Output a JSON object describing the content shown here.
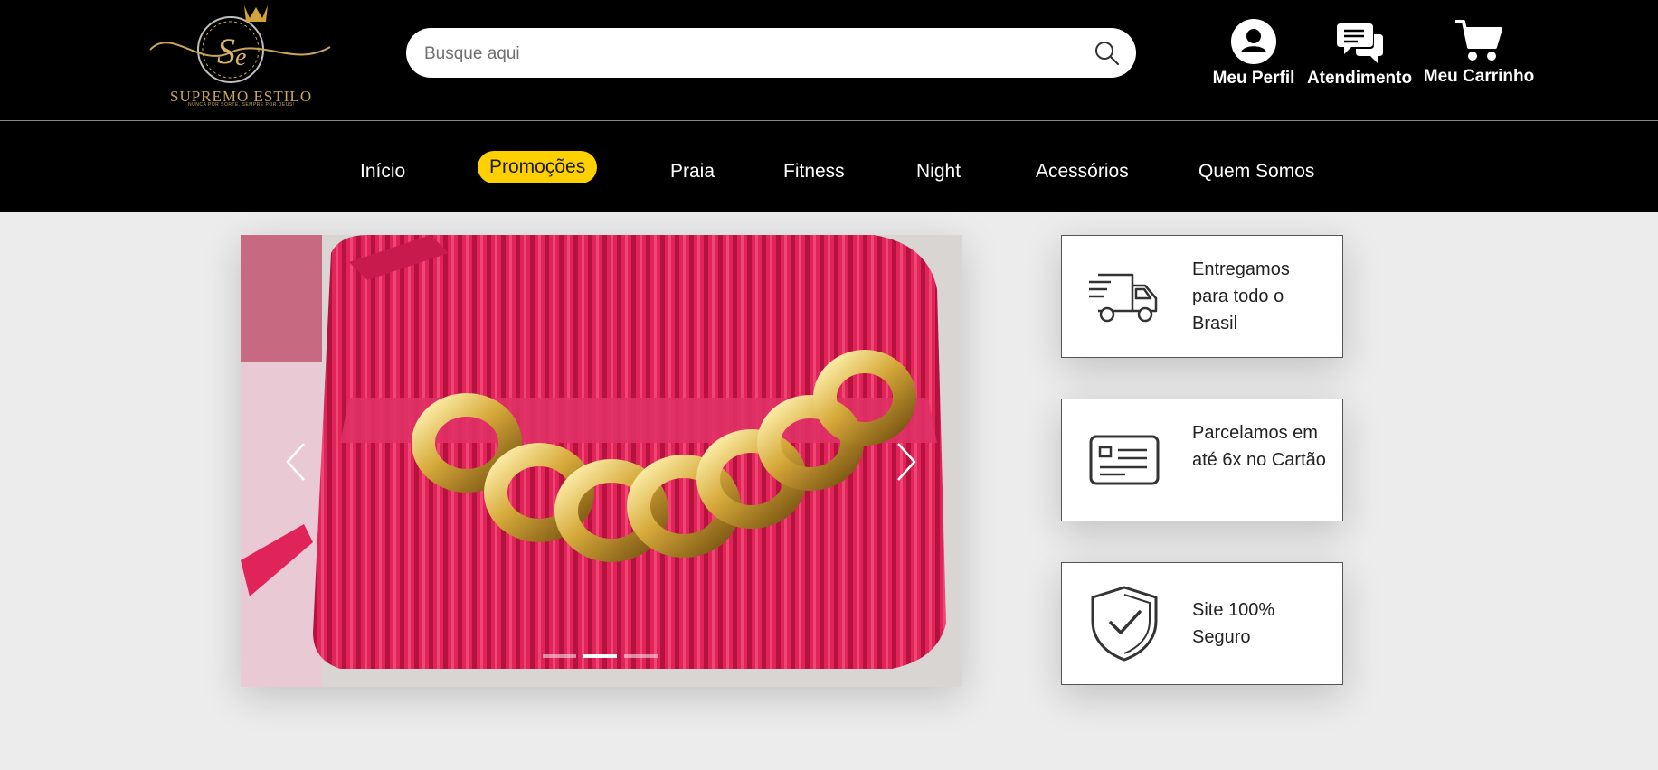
{
  "header": {
    "logo": {
      "brand": "SUPREMO ESTILO",
      "tagline": "NUNCA POR SORTE, SEMPRE POR DEUS!",
      "monogram": "Se"
    },
    "search": {
      "placeholder": "Busque aqui",
      "value": ""
    },
    "actions": [
      {
        "label": "Meu Perfil",
        "icon": "user-icon"
      },
      {
        "label": "Atendimento",
        "icon": "chat-icon"
      },
      {
        "label": "Meu Carrinho",
        "icon": "cart-icon"
      }
    ]
  },
  "nav": {
    "items": [
      {
        "label": "Início"
      },
      {
        "label": "Promoções",
        "active": true
      },
      {
        "label": "Praia"
      },
      {
        "label": "Fitness"
      },
      {
        "label": "Night"
      },
      {
        "label": "Acessórios"
      },
      {
        "label": "Quem Somos"
      }
    ],
    "active_color": "#ffd000"
  },
  "carousel": {
    "slide_count": 3,
    "active_slide": 2,
    "prev_icon": "chevron-left-icon",
    "next_icon": "chevron-right-icon"
  },
  "features": [
    {
      "icon": "truck-icon",
      "text": "Entregamos para todo o Brasil"
    },
    {
      "icon": "credit-card-icon",
      "text": "Parcelamos em até 6x no Cartão"
    },
    {
      "icon": "shield-check-icon",
      "text": "Site 100% Seguro"
    }
  ],
  "colors": {
    "header_bg": "#000000",
    "page_bg": "#ececec",
    "accent": "#ffd000",
    "logo_gold": "#c9a55a"
  }
}
